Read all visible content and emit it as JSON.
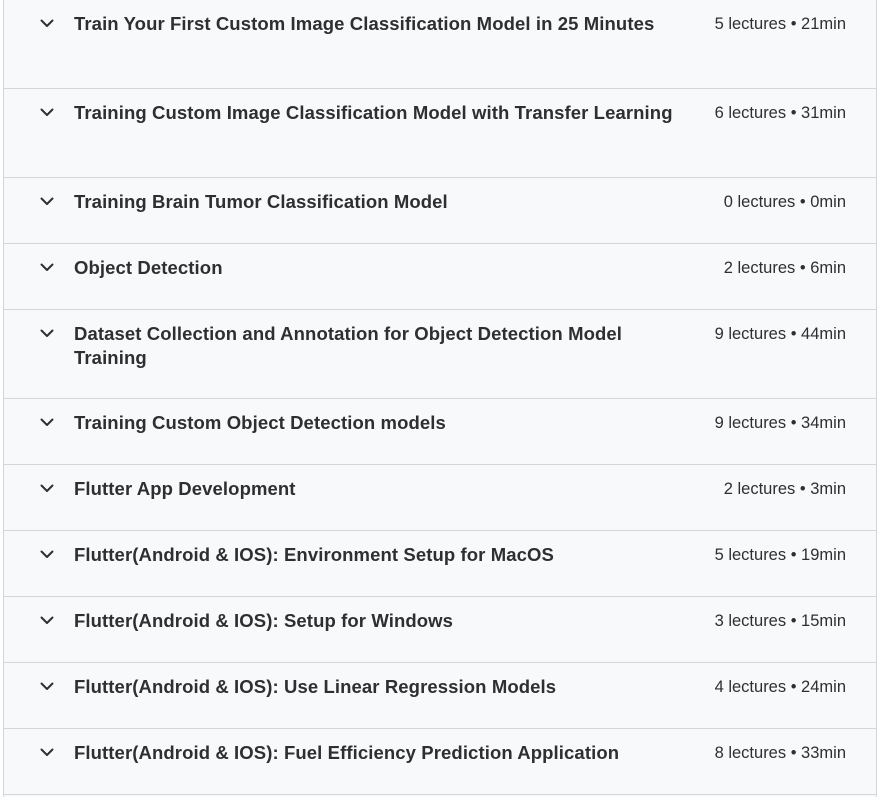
{
  "sections": [
    {
      "title": "Train Your First Custom Image Classification Model in 25 Minutes",
      "meta": "5 lectures • 21min",
      "lines": 2
    },
    {
      "title": "Training Custom Image Classification Model with Transfer Learning",
      "meta": "6 lectures • 31min",
      "lines": 2
    },
    {
      "title": "Training Brain Tumor Classification Model",
      "meta": "0 lectures • 0min",
      "lines": 1
    },
    {
      "title": "Object Detection",
      "meta": "2 lectures • 6min",
      "lines": 1
    },
    {
      "title": "Dataset Collection and Annotation for Object Detection Model Training",
      "meta": "9 lectures • 44min",
      "lines": 2
    },
    {
      "title": "Training Custom Object Detection models",
      "meta": "9 lectures • 34min",
      "lines": 1
    },
    {
      "title": "Flutter App Development",
      "meta": "2 lectures • 3min",
      "lines": 1
    },
    {
      "title": "Flutter(Android & IOS): Environment Setup for MacOS",
      "meta": "5 lectures • 19min",
      "lines": 1
    },
    {
      "title": "Flutter(Android & IOS): Setup for Windows",
      "meta": "3 lectures • 15min",
      "lines": 1
    },
    {
      "title": "Flutter(Android & IOS): Use Linear Regression Models",
      "meta": "4 lectures • 24min",
      "lines": 1
    },
    {
      "title": "Flutter(Android & IOS): Fuel Efficiency Prediction Application",
      "meta": "8 lectures • 33min",
      "lines": 1
    }
  ],
  "icons": {
    "expand": "chevron-down-icon"
  },
  "colors": {
    "text": "#2d2f31",
    "border": "#d1d7dc",
    "background": "#f7f9fa"
  }
}
